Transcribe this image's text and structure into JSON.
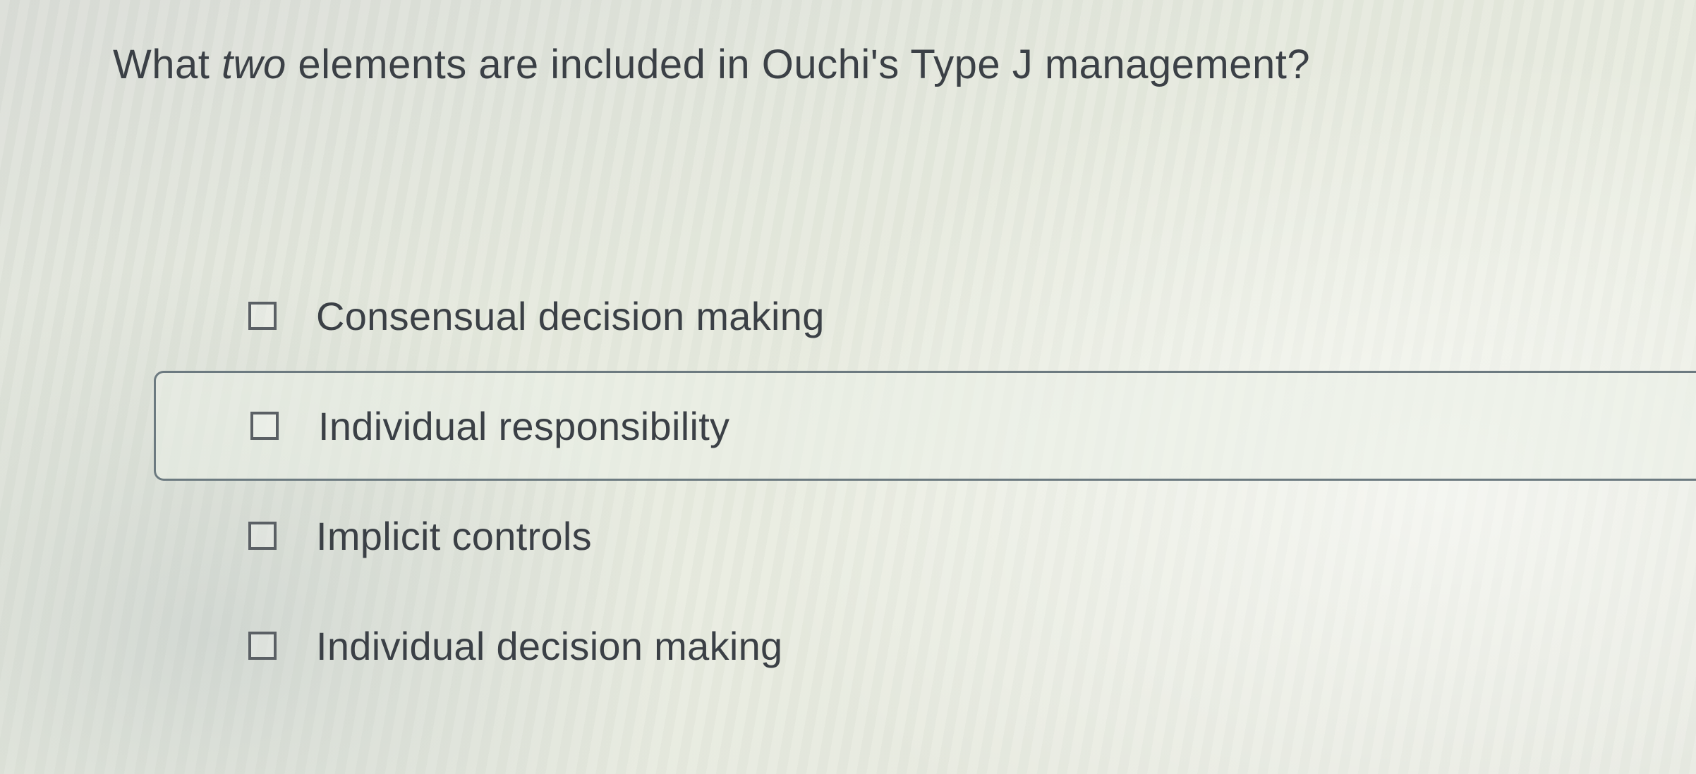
{
  "question": {
    "prefix": "What ",
    "emphasis": "two",
    "suffix": " elements are included in Ouchi's Type J management?"
  },
  "options": [
    {
      "label": "Consensual decision making",
      "checked": false
    },
    {
      "label": "Individual responsibility",
      "checked": false
    },
    {
      "label": "Implicit controls",
      "checked": false
    },
    {
      "label": "Individual decision making",
      "checked": false
    }
  ]
}
